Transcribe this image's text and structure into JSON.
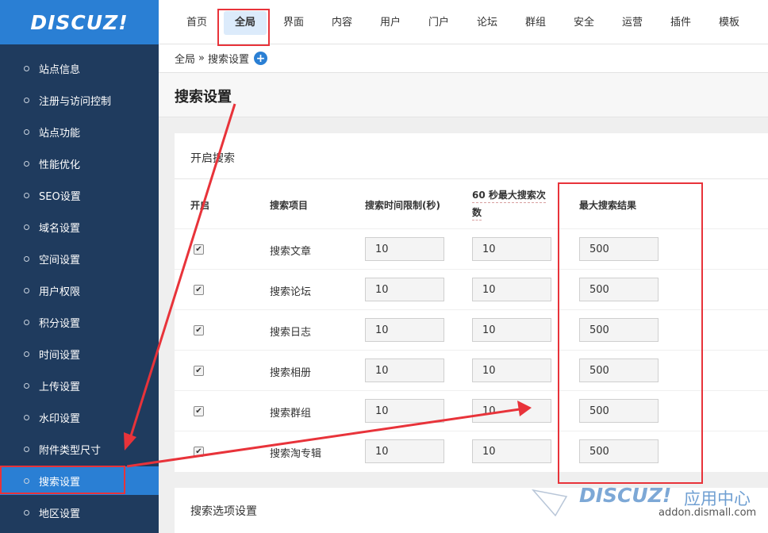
{
  "logo": "DISCUZ!",
  "topnav": [
    "首页",
    "全局",
    "界面",
    "内容",
    "用户",
    "门户",
    "论坛",
    "群组",
    "安全",
    "运营",
    "插件",
    "模板"
  ],
  "sidebar": [
    "站点信息",
    "注册与访问控制",
    "站点功能",
    "性能优化",
    "SEO设置",
    "域名设置",
    "空间设置",
    "用户权限",
    "积分设置",
    "时间设置",
    "上传设置",
    "水印设置",
    "附件类型尺寸",
    "搜索设置",
    "地区设置"
  ],
  "breadcrumb": {
    "parent": "全局",
    "sep": "»",
    "current": "搜索设置",
    "add": "+"
  },
  "page_title": "搜索设置",
  "section1": {
    "title": "开启搜索",
    "headers": {
      "enable": "开启",
      "item": "搜索项目",
      "time_limit": "搜索时间限制(秒)",
      "per60_a": "60 秒最大搜索次",
      "per60_b": "数",
      "max_results": "最大搜索结果"
    },
    "rows": [
      {
        "label": "搜索文章",
        "checked": true,
        "time_limit": "10",
        "per60": "10",
        "max_results": "500"
      },
      {
        "label": "搜索论坛",
        "checked": true,
        "time_limit": "10",
        "per60": "10",
        "max_results": "500"
      },
      {
        "label": "搜索日志",
        "checked": true,
        "time_limit": "10",
        "per60": "10",
        "max_results": "500"
      },
      {
        "label": "搜索相册",
        "checked": true,
        "time_limit": "10",
        "per60": "10",
        "max_results": "500"
      },
      {
        "label": "搜索群组",
        "checked": true,
        "time_limit": "10",
        "per60": "10",
        "max_results": "500"
      },
      {
        "label": "搜索淘专辑",
        "checked": true,
        "time_limit": "10",
        "per60": "10",
        "max_results": "500"
      }
    ]
  },
  "section2": {
    "title": "搜索选项设置"
  },
  "watermark": {
    "logo": "DISCUZ!",
    "center": "应用中心",
    "url": "addon.dismall.com"
  },
  "annotation_color": "#e8333a"
}
